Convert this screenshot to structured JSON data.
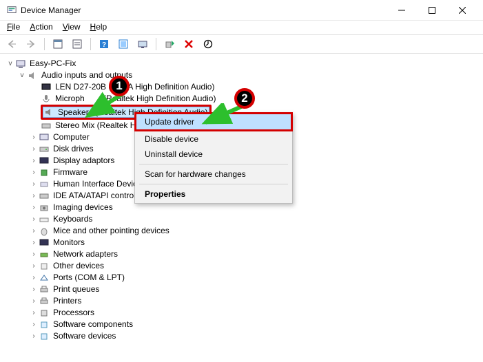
{
  "window": {
    "title": "Device Manager"
  },
  "menu": {
    "file": "File",
    "action": "Action",
    "view": "View",
    "help": "Help"
  },
  "tree": {
    "root": "Easy-PC-Fix",
    "audio_cat": "Audio inputs and outputs",
    "audio_children": {
      "a0": "LEN D27-20B (",
      "a0b": "A High Definition Audio)",
      "a1": "Microph",
      "a1b": " (Realtek High Definition Audio)",
      "a2": "Speakers (Realtek High Definition Audio)",
      "a3": "Stereo Mix (Realtek H"
    },
    "cats": {
      "c0": "Computer",
      "c1": "Disk drives",
      "c2": "Display adaptors",
      "c3": "Firmware",
      "c4": "Human Interface Device",
      "c5": "IDE ATA/ATAPI controlle",
      "c6": "Imaging devices",
      "c7": "Keyboards",
      "c8": "Mice and other pointing devices",
      "c9": "Monitors",
      "c10": "Network adapters",
      "c11": "Other devices",
      "c12": "Ports (COM & LPT)",
      "c13": "Print queues",
      "c14": "Printers",
      "c15": "Processors",
      "c16": "Software components",
      "c17": "Software devices"
    }
  },
  "context_menu": {
    "update": "Update driver",
    "disable": "Disable device",
    "uninstall": "Uninstall device",
    "scan": "Scan for hardware changes",
    "properties": "Properties"
  },
  "annotations": {
    "badge1": "1",
    "badge2": "2"
  }
}
